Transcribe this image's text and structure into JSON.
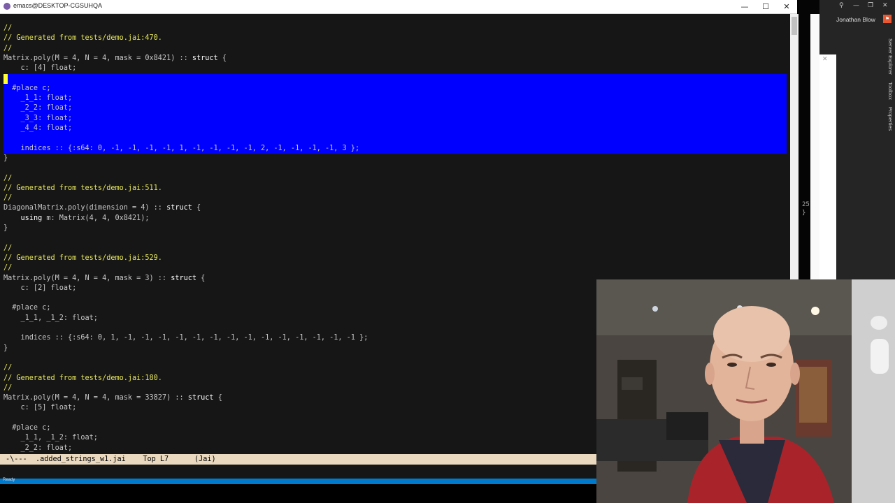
{
  "window": {
    "title": "emacs@DESKTOP-CGSUHQA"
  },
  "titlebar_buttons": {
    "minimize": "—",
    "maximize": "☐",
    "close": "✕"
  },
  "editor": {
    "lines": [
      [
        {
          "t": "//",
          "c": "c"
        }
      ],
      [
        {
          "t": "// Generated from tests/demo.jai:470.",
          "c": "c"
        }
      ],
      [
        {
          "t": "//",
          "c": "c"
        }
      ],
      [
        {
          "t": "Matrix.poly(M = 4, N = 4, mask = 0x8421) :: ",
          "c": "t"
        },
        {
          "t": "struct",
          "c": "kw"
        },
        {
          "t": " {",
          "c": "t"
        }
      ],
      [
        {
          "t": "    c: [4] float;",
          "c": "t"
        }
      ],
      [
        {
          "t": "",
          "c": "t"
        }
      ],
      [
        {
          "t": "  #place c;",
          "c": "t"
        }
      ],
      [
        {
          "t": "    _1_1: float;",
          "c": "t"
        }
      ],
      [
        {
          "t": "    _2_2: float;",
          "c": "t"
        }
      ],
      [
        {
          "t": "    _3_3: float;",
          "c": "t"
        }
      ],
      [
        {
          "t": "    _4_4: float;",
          "c": "t"
        }
      ],
      [
        {
          "t": "",
          "c": "t"
        }
      ],
      [
        {
          "t": "    indices :: {:s64: 0, -1, -1, -1, -1, 1, -1, -1, -1, -1, 2, -1, -1, -1, -1, 3 };",
          "c": "t"
        }
      ],
      [
        {
          "t": "}",
          "c": "t"
        }
      ],
      [
        {
          "t": "",
          "c": "t"
        }
      ],
      [
        {
          "t": "//",
          "c": "c"
        }
      ],
      [
        {
          "t": "// Generated from tests/demo.jai:511.",
          "c": "c"
        }
      ],
      [
        {
          "t": "//",
          "c": "c"
        }
      ],
      [
        {
          "t": "DiagonalMatrix.poly(dimension = 4) :: ",
          "c": "t"
        },
        {
          "t": "struct",
          "c": "kw"
        },
        {
          "t": " {",
          "c": "t"
        }
      ],
      [
        {
          "t": "    ",
          "c": "t"
        },
        {
          "t": "using",
          "c": "kw"
        },
        {
          "t": " m: Matrix(4, 4, 0x8421);",
          "c": "t"
        }
      ],
      [
        {
          "t": "}",
          "c": "t"
        }
      ],
      [
        {
          "t": "",
          "c": "t"
        }
      ],
      [
        {
          "t": "//",
          "c": "c"
        }
      ],
      [
        {
          "t": "// Generated from tests/demo.jai:529.",
          "c": "c"
        }
      ],
      [
        {
          "t": "//",
          "c": "c"
        }
      ],
      [
        {
          "t": "Matrix.poly(M = 4, N = 4, mask = 3) :: ",
          "c": "t"
        },
        {
          "t": "struct",
          "c": "kw"
        },
        {
          "t": " {",
          "c": "t"
        }
      ],
      [
        {
          "t": "    c: [2] float;",
          "c": "t"
        }
      ],
      [
        {
          "t": "",
          "c": "t"
        }
      ],
      [
        {
          "t": "  #place c;",
          "c": "t"
        }
      ],
      [
        {
          "t": "    _1_1, _1_2: float;",
          "c": "t"
        }
      ],
      [
        {
          "t": "",
          "c": "t"
        }
      ],
      [
        {
          "t": "    indices :: {:s64: 0, 1, -1, -1, -1, -1, -1, -1, -1, -1, -1, -1, -1, -1, -1, -1 };",
          "c": "t"
        }
      ],
      [
        {
          "t": "}",
          "c": "t"
        }
      ],
      [
        {
          "t": "",
          "c": "t"
        }
      ],
      [
        {
          "t": "//",
          "c": "c"
        }
      ],
      [
        {
          "t": "// Generated from tests/demo.jai:180.",
          "c": "c"
        }
      ],
      [
        {
          "t": "//",
          "c": "c"
        }
      ],
      [
        {
          "t": "Matrix.poly(M = 4, N = 4, mask = 33827) :: ",
          "c": "t"
        },
        {
          "t": "struct",
          "c": "kw"
        },
        {
          "t": " {",
          "c": "t"
        }
      ],
      [
        {
          "t": "    c: [5] float;",
          "c": "t"
        }
      ],
      [
        {
          "t": "",
          "c": "t"
        }
      ],
      [
        {
          "t": "  #place c;",
          "c": "t"
        }
      ],
      [
        {
          "t": "    _1_1, _1_2: float;",
          "c": "t"
        }
      ],
      [
        {
          "t": "    _2_2: float;",
          "c": "t"
        }
      ]
    ]
  },
  "modeline": {
    "flags": "-\\---",
    "buffer": ".added_strings_w1.jai",
    "position": "Top L7",
    "mode": "(Jai)"
  },
  "side_panel": {
    "num": "25",
    "brace": "}"
  },
  "vs": {
    "user": "Jonathan Blow",
    "tabs": [
      "Server Explorer",
      "Toolbox",
      "Properties"
    ]
  },
  "statusbar": {
    "text": "Ready"
  }
}
